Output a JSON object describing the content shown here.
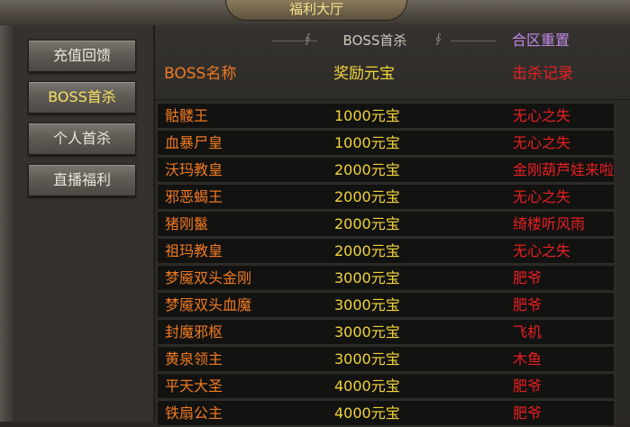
{
  "window": {
    "title": "福利大厅"
  },
  "sidebar": {
    "items": [
      {
        "label": "充值回馈",
        "active": false
      },
      {
        "label": "BOSS首杀",
        "active": true
      },
      {
        "label": "个人首杀",
        "active": false
      },
      {
        "label": "直播福利",
        "active": false
      }
    ]
  },
  "panel": {
    "title": "BOSS首杀",
    "reset_label": "合区重置",
    "columns": {
      "name": "BOSS名称",
      "reward": "奖励元宝",
      "kill": "击杀记录"
    },
    "rows": [
      {
        "name": "骷髅王",
        "reward": "1000元宝",
        "kill": "无心之失"
      },
      {
        "name": "血暴尸皇",
        "reward": "1000元宝",
        "kill": "无心之失"
      },
      {
        "name": "沃玛教皇",
        "reward": "2000元宝",
        "kill": "金刚葫芦娃来啦"
      },
      {
        "name": "邪恶蝎王",
        "reward": "2000元宝",
        "kill": "无心之失"
      },
      {
        "name": "猪刚鬣",
        "reward": "2000元宝",
        "kill": "绮楼听风雨"
      },
      {
        "name": "祖玛教皇",
        "reward": "2000元宝",
        "kill": "无心之失"
      },
      {
        "name": "梦魇双头金刚",
        "reward": "3000元宝",
        "kill": "肥爷"
      },
      {
        "name": "梦魇双头血魔",
        "reward": "3000元宝",
        "kill": "肥爷"
      },
      {
        "name": "封魔邪枢",
        "reward": "3000元宝",
        "kill": "飞机"
      },
      {
        "name": "黄泉领主",
        "reward": "3000元宝",
        "kill": "木鱼"
      },
      {
        "name": "平天大圣",
        "reward": "4000元宝",
        "kill": "肥爷"
      },
      {
        "name": "铁扇公主",
        "reward": "4000元宝",
        "kill": "肥爷"
      }
    ]
  },
  "colors": {
    "name": "#f07a20",
    "reward": "#f2d43a",
    "kill": "#e82020",
    "reset": "#c089e6",
    "active_tab": "#f6e063"
  }
}
